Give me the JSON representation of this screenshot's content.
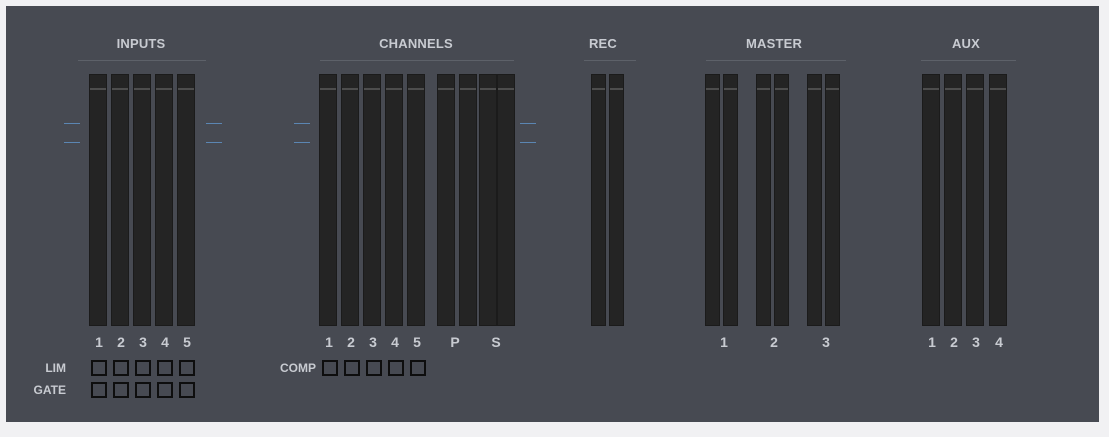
{
  "sections": {
    "inputs": {
      "title": "INPUTS",
      "channels": [
        "1",
        "2",
        "3",
        "4",
        "5"
      ]
    },
    "channels": {
      "title": "CHANNELS",
      "channels": [
        "1",
        "2",
        "3",
        "4",
        "5",
        "P",
        "S"
      ]
    },
    "rec": {
      "title": "REC",
      "channels": []
    },
    "master": {
      "title": "MASTER",
      "channels": [
        "1",
        "2",
        "3"
      ]
    },
    "aux": {
      "title": "AUX",
      "channels": [
        "1",
        "2",
        "3",
        "4"
      ]
    }
  },
  "dynamics": {
    "lim_label": "LIM",
    "gate_label": "GATE",
    "comp_label": "COMP"
  },
  "colors": {
    "panel_bg": "#474a52",
    "meter_bg": "#242424",
    "tick_blue": "#5b86b3",
    "label_text": "#c8cbd1"
  }
}
